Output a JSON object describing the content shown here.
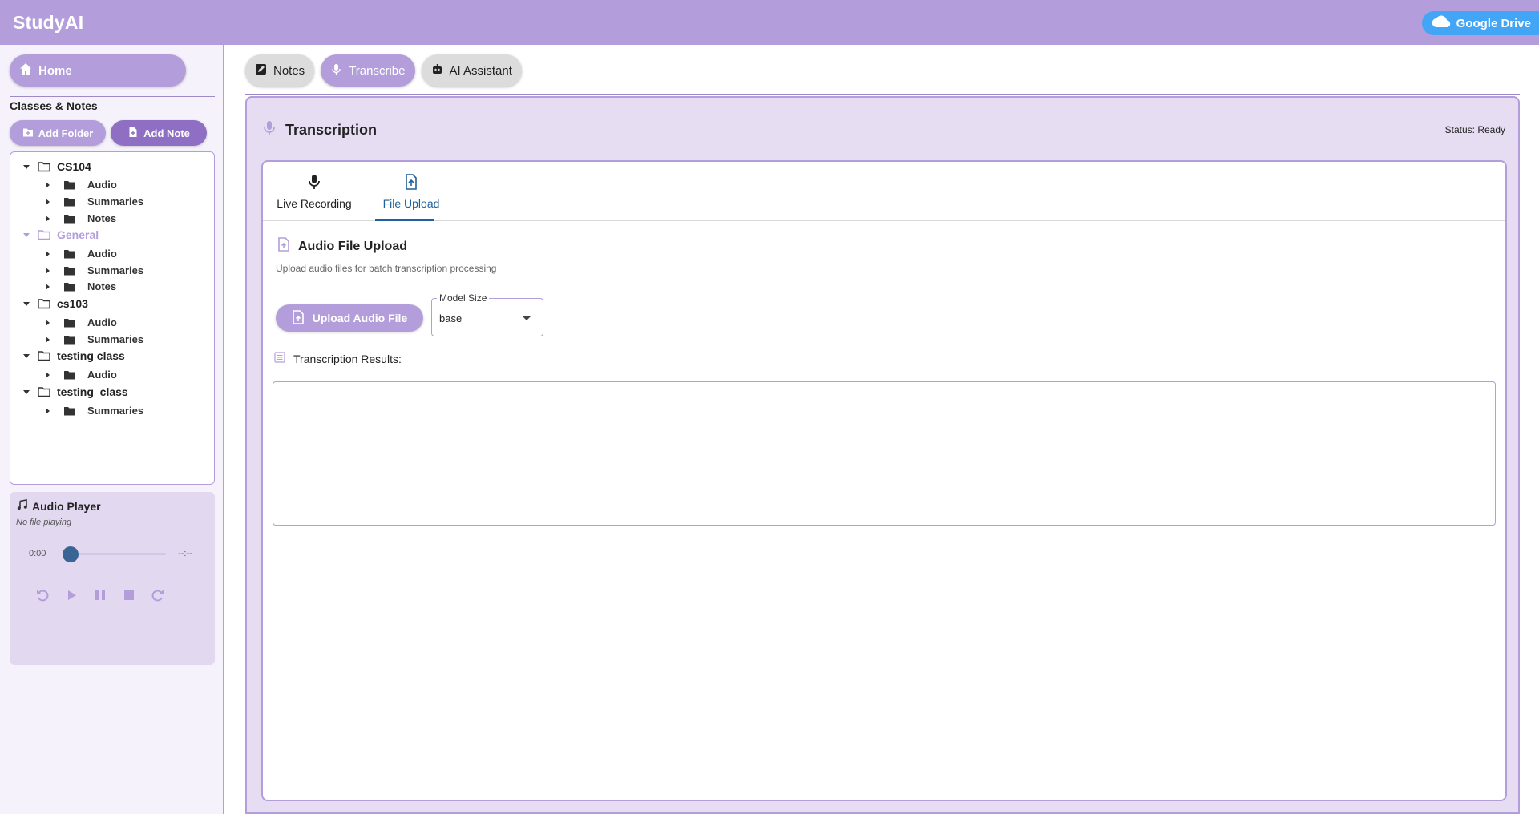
{
  "app": {
    "title": "StudyAI",
    "drive_label": "Google Drive"
  },
  "sidebar": {
    "home_label": "Home",
    "section_title": "Classes & Notes",
    "add_folder_label": "Add Folder",
    "add_note_label": "Add Note",
    "tree": [
      {
        "label": "CS104",
        "children": [
          "Audio",
          "Summaries",
          "Notes"
        ]
      },
      {
        "label": "General",
        "selected": true,
        "children": [
          "Audio",
          "Summaries",
          "Notes"
        ]
      },
      {
        "label": "cs103",
        "children": [
          "Audio",
          "Summaries"
        ]
      },
      {
        "label": "testing class",
        "children": [
          "Audio"
        ]
      },
      {
        "label": "testing_class",
        "children": [
          "Summaries"
        ]
      }
    ]
  },
  "player": {
    "title": "Audio Player",
    "subtitle": "No file playing",
    "current_time": "0:00",
    "duration": "--:--",
    "progress": 0
  },
  "tabs": [
    {
      "label": "Notes",
      "icon": "note-icon"
    },
    {
      "label": "Transcribe",
      "icon": "mic-icon",
      "active": true
    },
    {
      "label": "AI Assistant",
      "icon": "robot-icon"
    }
  ],
  "transcription": {
    "title": "Transcription",
    "status": "Status: Ready",
    "subtabs": [
      {
        "label": "Live Recording",
        "icon": "mic-icon"
      },
      {
        "label": "File Upload",
        "icon": "file-upload-icon",
        "active": true
      }
    ],
    "upload_title": "Audio File Upload",
    "upload_desc": "Upload audio files for batch transcription processing",
    "upload_button": "Upload Audio File",
    "model_label": "Model Size",
    "model_value": "base",
    "results_label": "Transcription Results:",
    "results_text": ""
  },
  "colors": {
    "primary": "#b39ddb",
    "secondary": "#8e6fc4",
    "drive": "#42a5f5",
    "active_tab": "#1f5f9a"
  }
}
